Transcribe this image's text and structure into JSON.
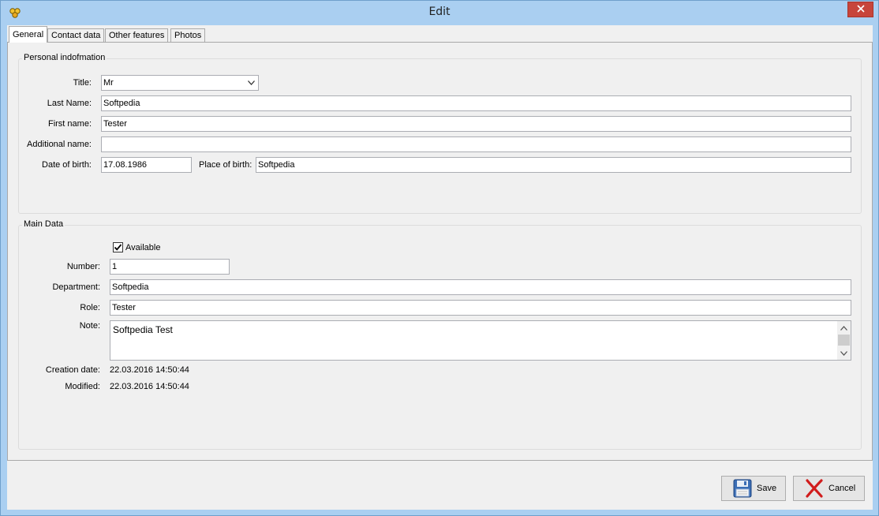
{
  "window": {
    "title": "Edit",
    "icons": {
      "app": "app-icon",
      "close": "close-icon"
    },
    "colors": {
      "frame": "#aacff1",
      "close": "#c7453b",
      "panel": "#f0f0f0"
    }
  },
  "tabs": [
    {
      "label": "General",
      "active": true
    },
    {
      "label": "Contact data",
      "active": false
    },
    {
      "label": "Other features",
      "active": false
    },
    {
      "label": "Photos",
      "active": false
    }
  ],
  "personal": {
    "legend": "Personal indofmation",
    "title_label": "Title:",
    "title_value": "Mr",
    "last_name_label": "Last Name:",
    "last_name_value": "Softpedia",
    "first_name_label": "First name:",
    "first_name_value": "Tester",
    "additional_name_label": "Additional name:",
    "additional_name_value": "",
    "dob_label": "Date of birth:",
    "dob_value": "17.08.1986",
    "pob_label": "Place of birth:",
    "pob_value": "Softpedia"
  },
  "main": {
    "legend": "Main Data",
    "available_label": "Available",
    "available_checked": true,
    "number_label": "Number:",
    "number_value": "1",
    "department_label": "Department:",
    "department_value": "Softpedia",
    "role_label": "Role:",
    "role_value": "Tester",
    "note_label": "Note:",
    "note_value": "Softpedia Test",
    "creation_label": "Creation date:",
    "creation_value": "22.03.2016  14:50:44",
    "modified_label": "Modified:",
    "modified_value": "22.03.2016  14:50:44"
  },
  "buttons": {
    "save_label": "Save",
    "save_icon": "floppy-disk-icon",
    "cancel_label": "Cancel",
    "cancel_icon": "red-x-icon"
  }
}
